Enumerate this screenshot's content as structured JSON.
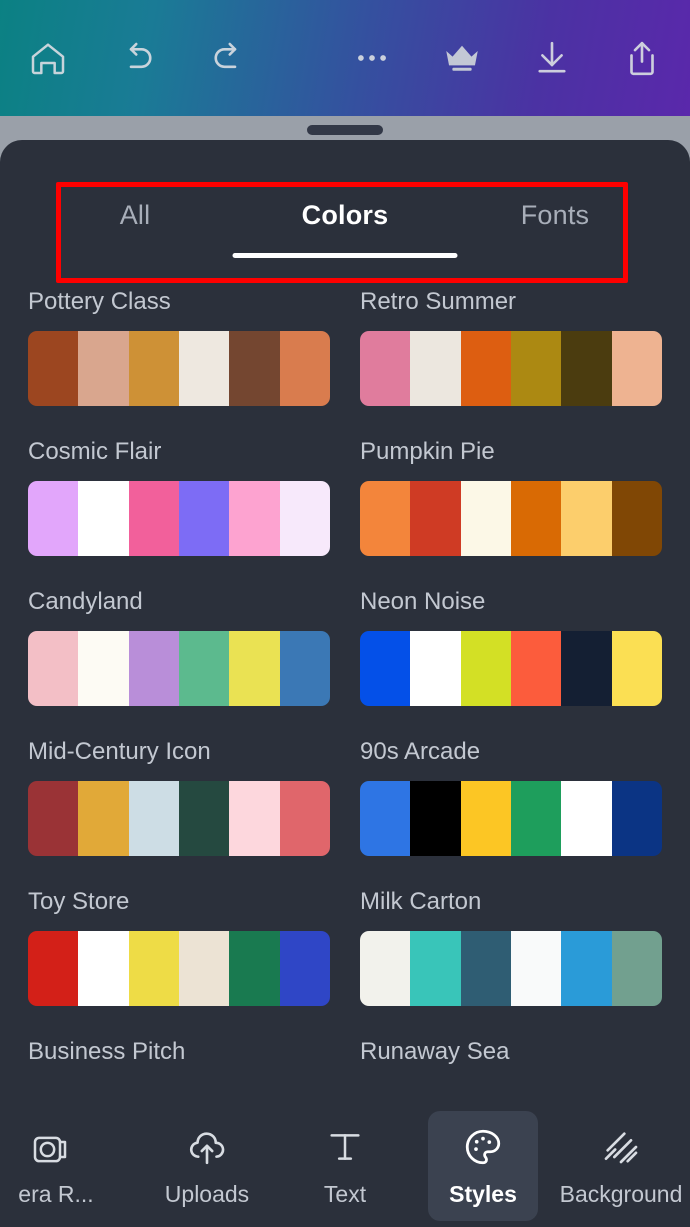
{
  "topbar": {
    "left_icons": [
      {
        "name": "home-icon",
        "label": "Home"
      },
      {
        "name": "undo-icon",
        "label": "Undo"
      },
      {
        "name": "redo-icon",
        "label": "Redo"
      }
    ],
    "right_icons": [
      {
        "name": "more-options-icon",
        "label": "More options"
      },
      {
        "name": "crown-icon",
        "label": "Pro"
      },
      {
        "name": "download-icon",
        "label": "Download"
      },
      {
        "name": "share-icon",
        "label": "Share"
      }
    ],
    "gradient_from": "#0b8183",
    "gradient_to": "#5a28ab"
  },
  "sheet": {
    "grip_label": "drag-handle"
  },
  "tabs": [
    {
      "label": "All",
      "active": false
    },
    {
      "label": "Colors",
      "active": true
    },
    {
      "label": "Fonts",
      "active": false
    }
  ],
  "annotation": {
    "color": "#fe0000",
    "target": "tabs-row"
  },
  "palettes": [
    {
      "name": "Pottery Class",
      "colors": [
        "#9c4620",
        "#d9a68e",
        "#ce9136",
        "#eee8e0",
        "#744630",
        "#d97c4e"
      ]
    },
    {
      "name": "Retro Summer",
      "colors": [
        "#e07c9d",
        "#ece7df",
        "#dd5e11",
        "#ac8912",
        "#4b3c0f",
        "#eeb391"
      ]
    },
    {
      "name": "Cosmic Flair",
      "colors": [
        "#e2a6fb",
        "#ffffff",
        "#f2609b",
        "#7d6cf5",
        "#fda3d0",
        "#f7e9fb"
      ]
    },
    {
      "name": "Pumpkin Pie",
      "colors": [
        "#f3853b",
        "#cf3b24",
        "#fcf8e7",
        "#d96a04",
        "#fcce6c",
        "#804705"
      ]
    },
    {
      "name": "Candyland",
      "colors": [
        "#f3bfc6",
        "#fdfbf4",
        "#b98ed9",
        "#5cba8e",
        "#eae253",
        "#3b78b5"
      ]
    },
    {
      "name": "Neon Noise",
      "colors": [
        "#0450e8",
        "#ffffff",
        "#d3e025",
        "#fc5c3c",
        "#141f33",
        "#fbdf53"
      ]
    },
    {
      "name": "Mid-Century Icon",
      "colors": [
        "#9a3336",
        "#e1a938",
        "#cddde5",
        "#254940",
        "#fdd7dd",
        "#e0666b"
      ]
    },
    {
      "name": "90s Arcade",
      "colors": [
        "#2e75e4",
        "#000000",
        "#fcc624",
        "#1e9e5c",
        "#ffffff",
        "#0b3484"
      ]
    },
    {
      "name": "Toy Store",
      "colors": [
        "#d32018",
        "#ffffff",
        "#eedc46",
        "#ece3d4",
        "#197a50",
        "#2f46c6"
      ]
    },
    {
      "name": "Milk Carton",
      "colors": [
        "#f2f2ec",
        "#39c5b9",
        "#2f5d73",
        "#f9fafa",
        "#2a9bd8",
        "#72a08f"
      ]
    },
    {
      "name": "Business Pitch",
      "colors": []
    },
    {
      "name": "Runaway Sea",
      "colors": []
    }
  ],
  "bottomnav": [
    {
      "label": "era R...",
      "icon": "camera-roll-icon",
      "active": false,
      "clipped": true
    },
    {
      "label": "Uploads",
      "icon": "upload-cloud-icon",
      "active": false,
      "clipped": false
    },
    {
      "label": "Text",
      "icon": "text-icon",
      "active": false,
      "clipped": false
    },
    {
      "label": "Styles",
      "icon": "palette-icon",
      "active": true,
      "clipped": false
    },
    {
      "label": "Background",
      "icon": "background-hatch-icon",
      "active": false,
      "clipped": false
    }
  ]
}
